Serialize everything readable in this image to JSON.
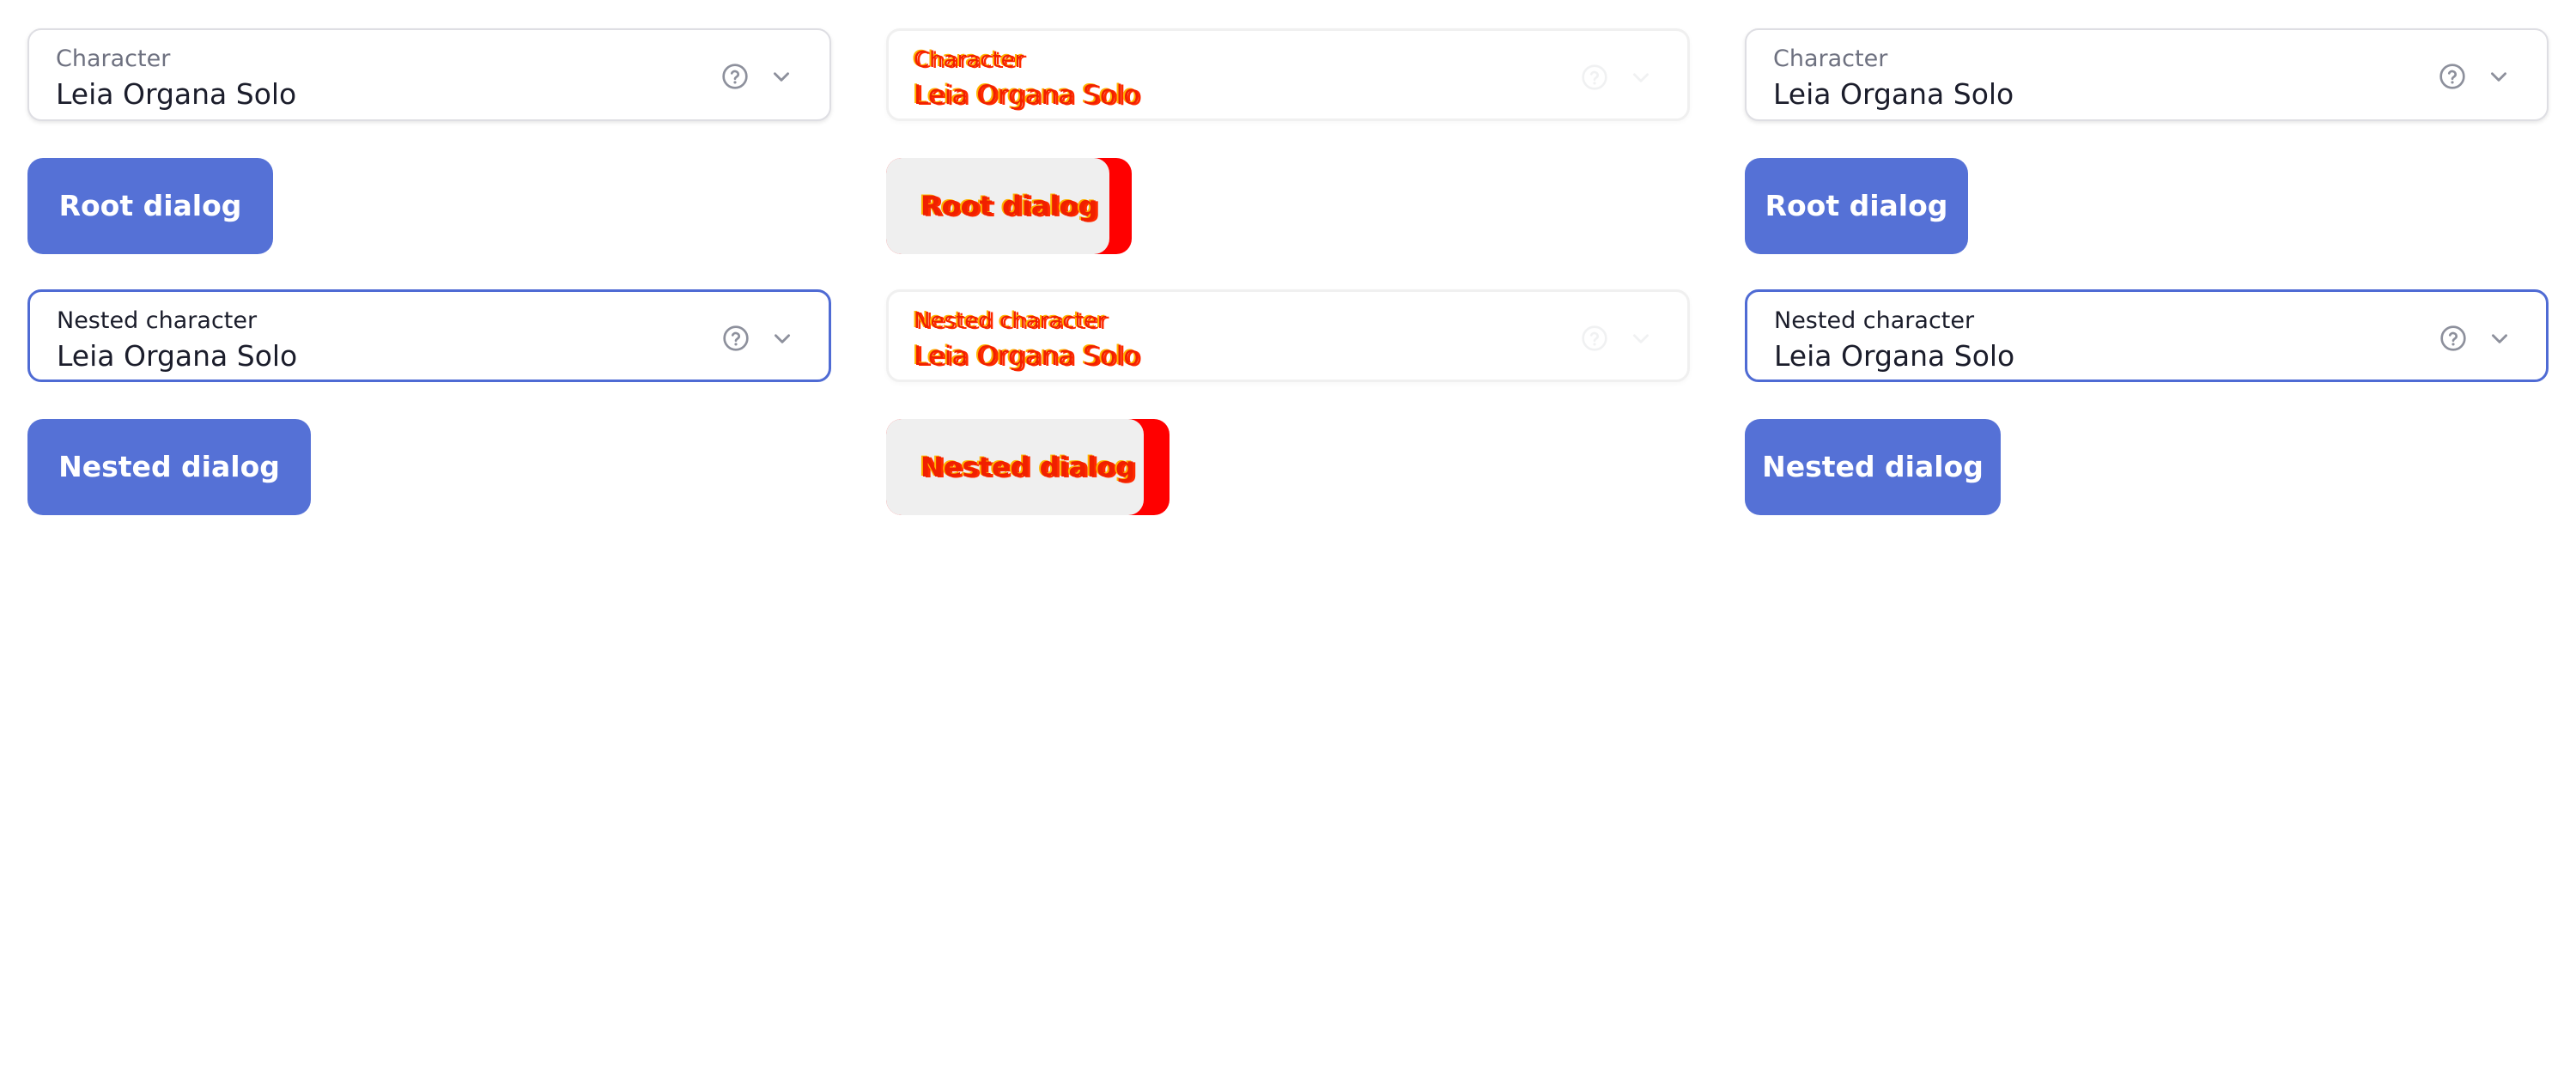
{
  "columns": [
    {
      "character": {
        "label": "Character",
        "value": "Leia Organa Solo"
      },
      "root_button": {
        "label": "Root dialog"
      },
      "nested_character": {
        "label": "Nested character",
        "value": "Leia Organa Solo"
      },
      "nested_button": {
        "label": "Nested dialog"
      }
    },
    {
      "character": {
        "label": "Character",
        "value": "Leia Organa Solo"
      },
      "root_button": {
        "label": "Root dialog"
      },
      "nested_character": {
        "label": "Nested character",
        "value": "Leia Organa Solo"
      },
      "nested_button": {
        "label": "Nested dialog"
      }
    },
    {
      "character": {
        "label": "Character",
        "value": "Leia Organa Solo"
      },
      "root_button": {
        "label": "Root dialog"
      },
      "nested_character": {
        "label": "Nested character",
        "value": "Leia Organa Solo"
      },
      "nested_button": {
        "label": "Nested dialog"
      }
    }
  ],
  "icons": {
    "help": "help-circle-icon",
    "expand": "chevron-down-icon"
  },
  "colors": {
    "accent": "#5571d6",
    "focus_border": "#4f6bd4",
    "diff_highlight": "#ff0000",
    "diff_text": "#f02000"
  }
}
